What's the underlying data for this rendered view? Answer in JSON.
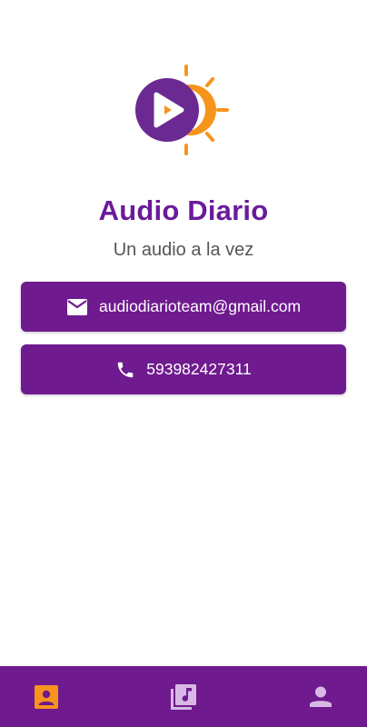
{
  "app": {
    "title": "Audio Diario",
    "subtitle": "Un audio a la vez"
  },
  "contact": {
    "email": "audiodiarioteam@gmail.com",
    "email_icon": "email-icon",
    "phone": "593982427311",
    "phone_icon": "phone-icon"
  },
  "bottom_nav": {
    "items": [
      {
        "icon": "contact-card-icon",
        "active": true
      },
      {
        "icon": "music-library-icon",
        "active": false
      },
      {
        "icon": "person-icon",
        "active": false
      }
    ]
  },
  "colors": {
    "primary": "#6f1a8e",
    "title": "#6a1b9a",
    "accent": "#f7941d",
    "nav_inactive": "#d7b8e6",
    "logo_circle": "#6a2a91"
  }
}
